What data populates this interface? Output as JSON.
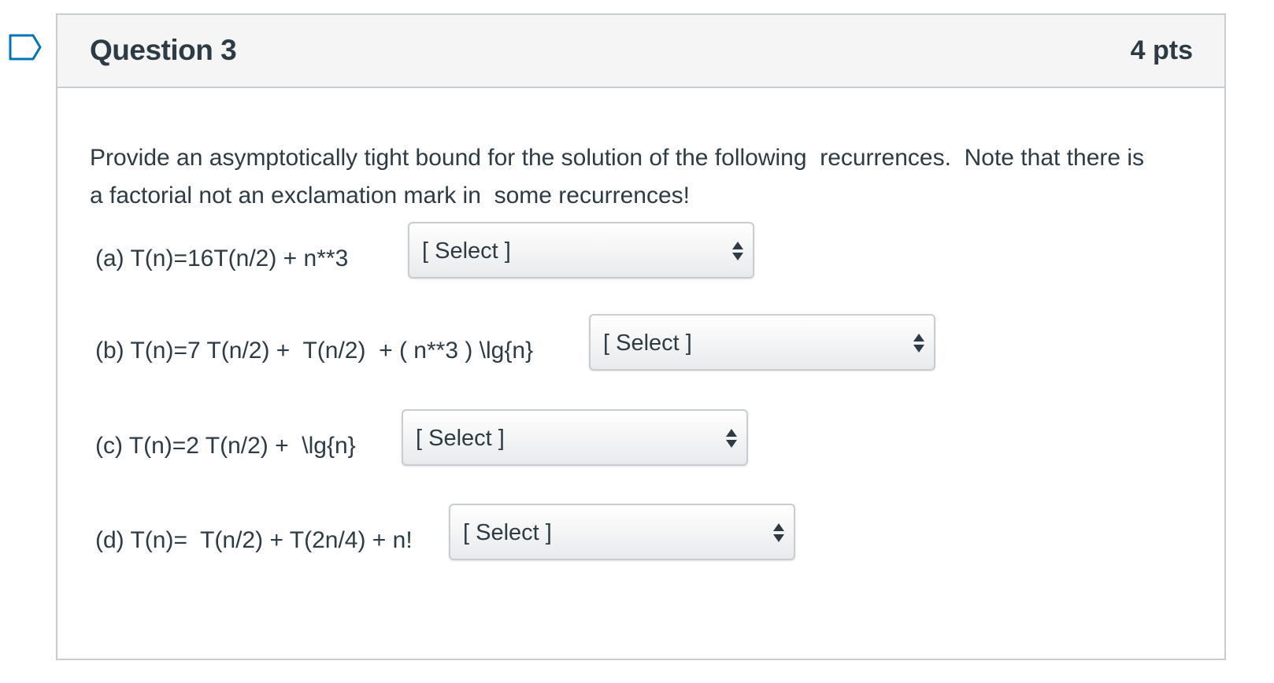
{
  "question": {
    "title": "Question 3",
    "points": "4 pts",
    "prompt": "Provide an asymptotically tight bound for the solution of the following  recurrences.  Note that there is a factorial not an exclamation mark in  some recurrences!",
    "flag_icon": "bookmark-flag-icon",
    "items": [
      {
        "label": "(a) T(n)=16T(n/2) + n**3",
        "selected": "[ Select ]"
      },
      {
        "label": "(b) T(n)=7 T(n/2) +  T(n/2)  + ( n**3 ) \\lg{n}",
        "selected": "[ Select ]"
      },
      {
        "label": "(c) T(n)=2 T(n/2) +  \\lg{n}",
        "selected": "[ Select ]"
      },
      {
        "label": "(d) T(n)=  T(n/2) + T(2n/4) + n!",
        "selected": "[ Select ]"
      }
    ]
  },
  "colors": {
    "text": "#2d3b45",
    "border": "#c7cdd1",
    "header_bg": "#f5f5f5",
    "flag": "#0374b5"
  }
}
